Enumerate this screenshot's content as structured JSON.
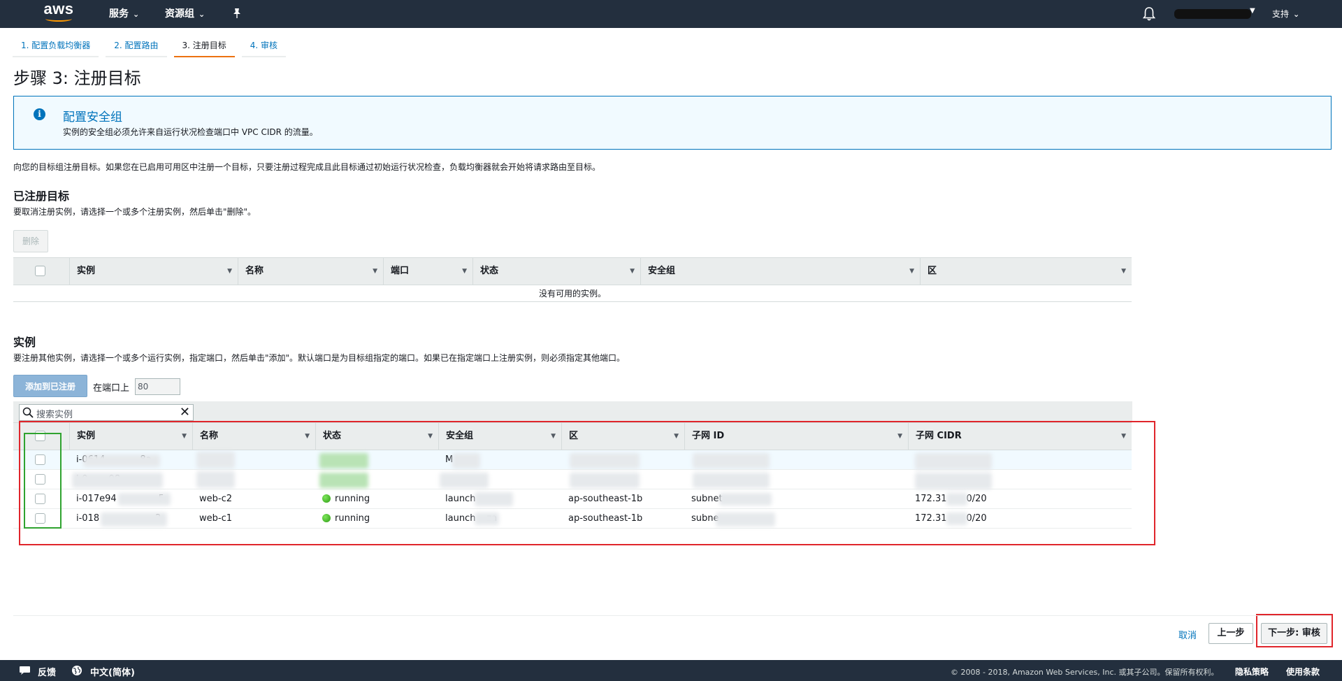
{
  "nav": {
    "logo": "aws",
    "services": "服务",
    "resource_groups": "资源组",
    "support": "支持"
  },
  "wizard": {
    "tabs": [
      "1. 配置负载均衡器",
      "2. 配置路由",
      "3. 注册目标",
      "4. 审核"
    ],
    "active_index": 2
  },
  "page_title": "步骤 3: 注册目标",
  "info": {
    "title": "配置安全组",
    "text": "实例的安全组必须允许来自运行状况检查端口中 VPC CIDR 的流量。"
  },
  "description": "向您的目标组注册目标。如果您在已启用可用区中注册一个目标，只要注册过程完成且此目标通过初始运行状况检查，负载均衡器就会开始将请求路由至目标。",
  "registered": {
    "title": "已注册目标",
    "desc": "要取消注册实例，请选择一个或多个注册实例，然后单击\"删除\"。",
    "remove_button": "删除",
    "columns": [
      "实例",
      "名称",
      "端口",
      "状态",
      "安全组",
      "区"
    ],
    "empty_text": "没有可用的实例。"
  },
  "instances": {
    "title": "实例",
    "desc": "要注册其他实例，请选择一个或多个运行实例，指定端口，然后单击\"添加\"。默认端口是为目标组指定的端口。如果已在指定端口上注册实例，则必须指定其他端口。",
    "add_button": "添加到已注册",
    "port_label": "在端口上",
    "port_value": "80",
    "search_placeholder": "搜索实例",
    "columns": [
      "实例",
      "名称",
      "状态",
      "安全组",
      "区",
      "子网 ID",
      "子网 CIDR"
    ],
    "rows": [
      {
        "instance": "i-0614",
        "instance_tail": "8a",
        "name": "",
        "state": "",
        "sg": "M",
        "zone": "",
        "subnet": "",
        "cidr": ""
      },
      {
        "instance": "i-0",
        "instance_tail": "98",
        "name": "",
        "state": "",
        "sg": "",
        "zone": "",
        "subnet": "",
        "cidr": ""
      },
      {
        "instance": "i-017e94",
        "instance_tail": "5",
        "name": "web-c2",
        "state": "running",
        "sg": "launch",
        "zone": "ap-southeast-1b",
        "subnet": "subnet",
        "cidr": "172.31",
        "cidr_tail": "0/20"
      },
      {
        "instance": "i-018",
        "instance_tail": "2",
        "name": "web-c1",
        "state": "running",
        "sg": "launch",
        "sg_tail": "za",
        "zone": "ap-southeast-1b",
        "subnet": "subne",
        "cidr": "172.31",
        "cidr_tail": "0/20"
      }
    ]
  },
  "actions": {
    "cancel": "取消",
    "previous": "上一步",
    "next": "下一步: 审核"
  },
  "footer": {
    "feedback": "反馈",
    "language": "中文(简体)",
    "copyright": "© 2008 - 2018, Amazon Web Services, Inc. 或其子公司。保留所有权利。",
    "privacy": "隐私策略",
    "terms": "使用条款"
  },
  "colors": {
    "nav_bg": "#232f3e",
    "accent": "#ec7211",
    "link": "#0073bb",
    "annotation_red": "#e0252b",
    "annotation_green": "#2fa32f"
  }
}
